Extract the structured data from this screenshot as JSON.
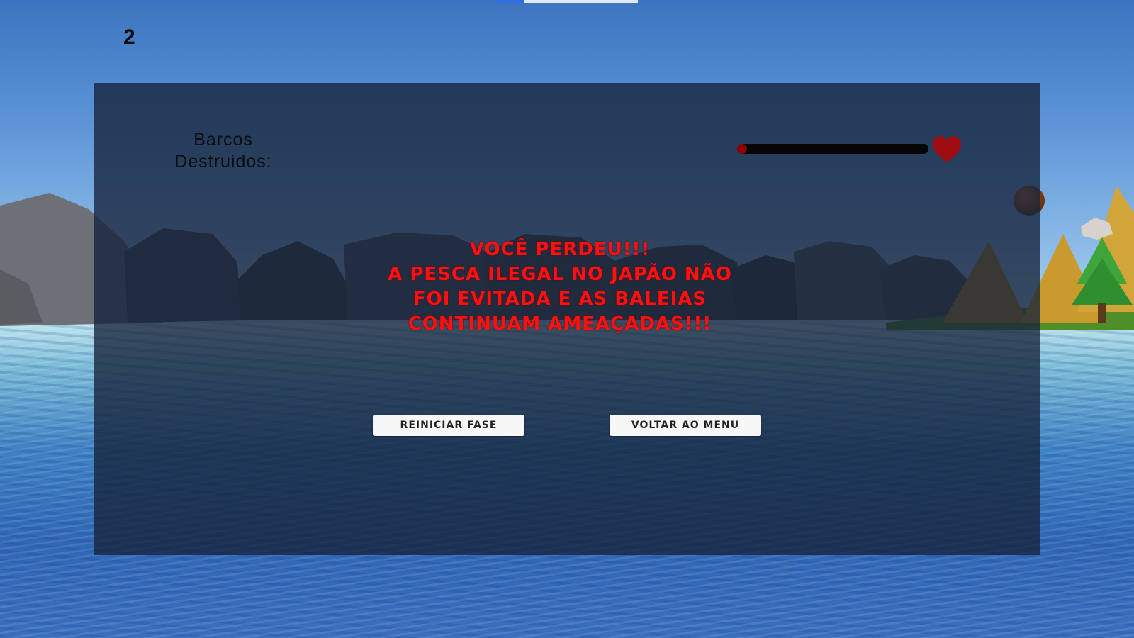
{
  "hud": {
    "score": "2",
    "boats_label": "Barcos\nDestruidos:",
    "health_fraction": 0.02
  },
  "game_over": {
    "lines": [
      "VOCÊ PERDEU!!!",
      "A PESCA ILEGAL NO JAPÃO NÃO",
      "FOI EVITADA E AS BALEIAS",
      "CONTINUAM AMEAÇADAS!!!"
    ],
    "text_color": "#ff1010"
  },
  "buttons": {
    "restart_label": "REINICIAR FASE",
    "menu_label": "VOLTAR AO MENU"
  },
  "icons": {
    "health": "heart-icon"
  }
}
